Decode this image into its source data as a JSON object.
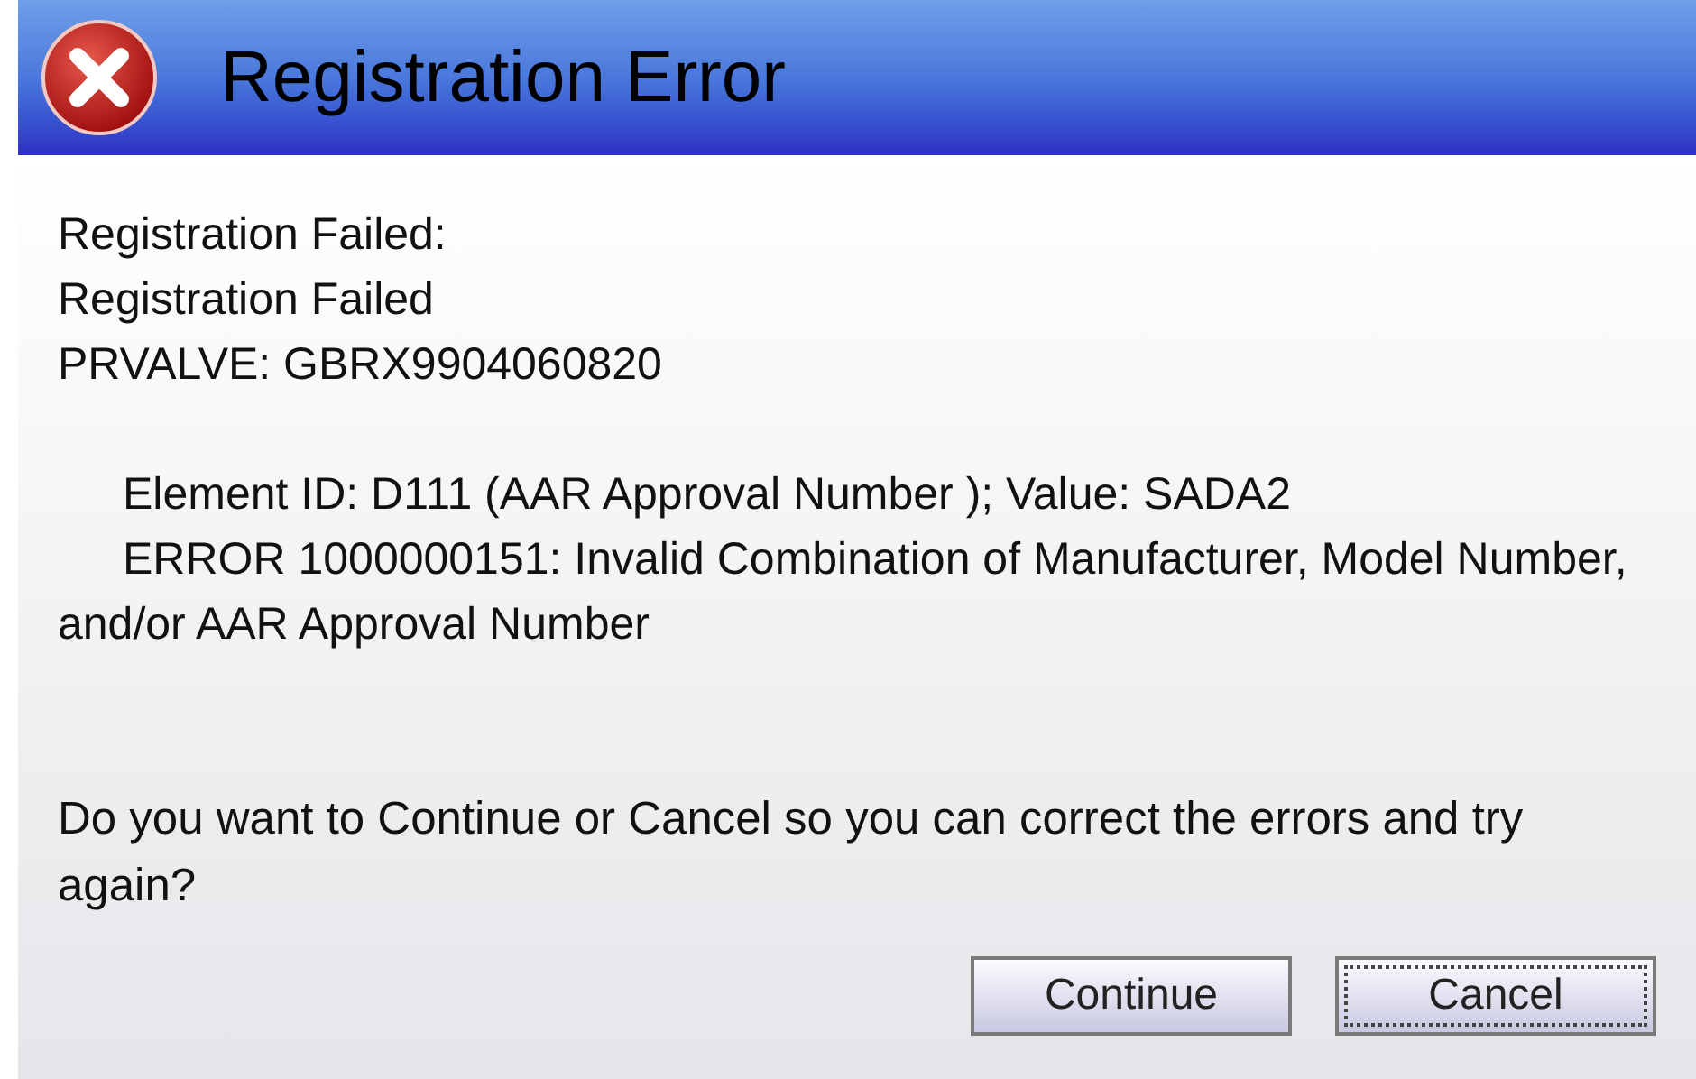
{
  "window": {
    "title": "Registration Error"
  },
  "message": [
    {
      "lines": [
        {
          "text": "Registration Failed:",
          "indented": false
        },
        {
          "text": "Registration Failed",
          "indented": false
        },
        {
          "text": "PRVALVE: GBRX9904060820",
          "indented": false
        }
      ]
    },
    {
      "lines": [
        {
          "text": "Element ID: D111 (AAR Approval Number ); Value: SADA2",
          "indented": true
        },
        {
          "text": "ERROR 1000000151: Invalid Combination of Manufacturer, Model Number, and/or AAR Approval Number",
          "indented": true
        }
      ]
    }
  ],
  "question": "Do you want to Continue or Cancel so you can correct the errors and try again?",
  "buttons": [
    {
      "label": "Continue",
      "focused": false
    },
    {
      "label": "Cancel",
      "focused": true
    }
  ]
}
